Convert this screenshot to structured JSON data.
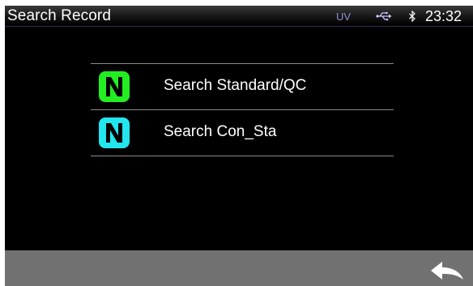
{
  "titlebar": {
    "title": "Search Record",
    "status_uv": "UV",
    "usb_icon": "usb-icon",
    "bluetooth_icon": "bluetooth-icon",
    "clock": "23:32"
  },
  "menu": {
    "items": [
      {
        "label": "Search Standard/QC",
        "icon": "n-logo-icon",
        "icon_color": "#22ee22"
      },
      {
        "label": "Search Con_Sta",
        "icon": "n-logo-icon",
        "icon_color": "#22e5ee"
      }
    ]
  },
  "bottombar": {
    "back_icon": "back-arrow-icon",
    "background": "#717171"
  }
}
